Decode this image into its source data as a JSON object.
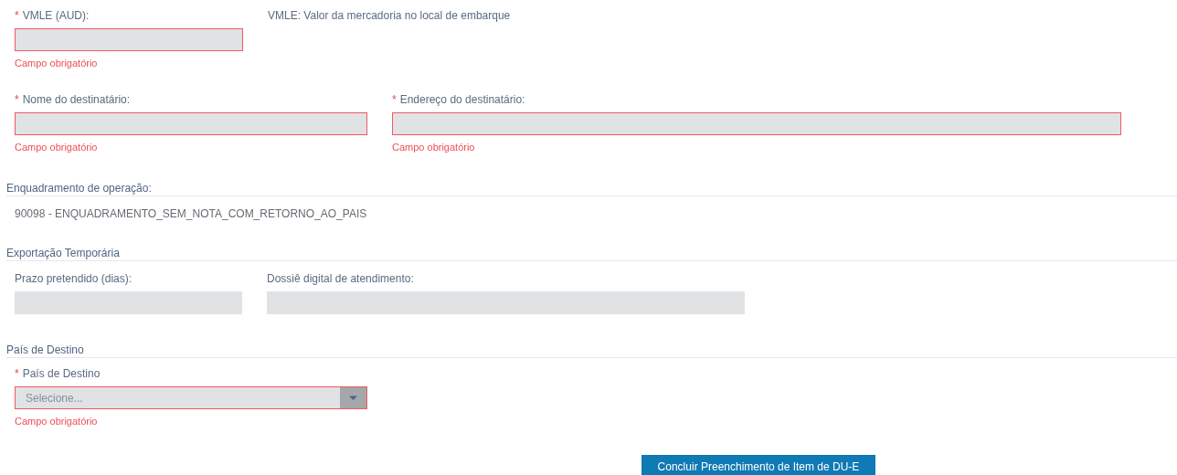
{
  "rows": [
    {
      "kind": "fields",
      "fields": [
        {
          "kind": "input",
          "label": "VMLE (AUD):",
          "required_mark": "*",
          "invalid": true,
          "error": "Campo obrigatório"
        }
      ],
      "note": "VMLE: Valor da mercadoria no local de embarque"
    },
    {
      "kind": "fields",
      "fields": [
        {
          "kind": "input",
          "label": "Nome do destinatário:",
          "required_mark": "*",
          "invalid": true,
          "error": "Campo obrigatório"
        },
        {
          "kind": "input",
          "label": "Endereço do destinatário:",
          "required_mark": "*",
          "invalid": true,
          "error": "Campo obrigatório"
        }
      ]
    },
    {
      "kind": "heading",
      "text": "Enquadramento de operação:"
    },
    {
      "kind": "value",
      "text": "90098 - ENQUADRAMENTO_SEM_NOTA_COM_RETORNO_AO_PAIS"
    },
    {
      "kind": "heading",
      "text": "Exportação Temporária"
    },
    {
      "kind": "fields",
      "fields": [
        {
          "kind": "input",
          "label": "Prazo pretendido (dias):",
          "invalid": false
        },
        {
          "kind": "input",
          "label": "Dossiê digital de atendimento:",
          "invalid": false
        }
      ]
    },
    {
      "kind": "heading",
      "text": "País de Destino"
    },
    {
      "kind": "fields",
      "fields": [
        {
          "kind": "select",
          "label": "País de Destino",
          "required_mark": "*",
          "invalid": true,
          "placeholder": "Selecione...",
          "error": "Campo obrigatório"
        }
      ]
    },
    {
      "kind": "button",
      "text": "Concluir Preenchimento de Item de DU-E"
    }
  ]
}
